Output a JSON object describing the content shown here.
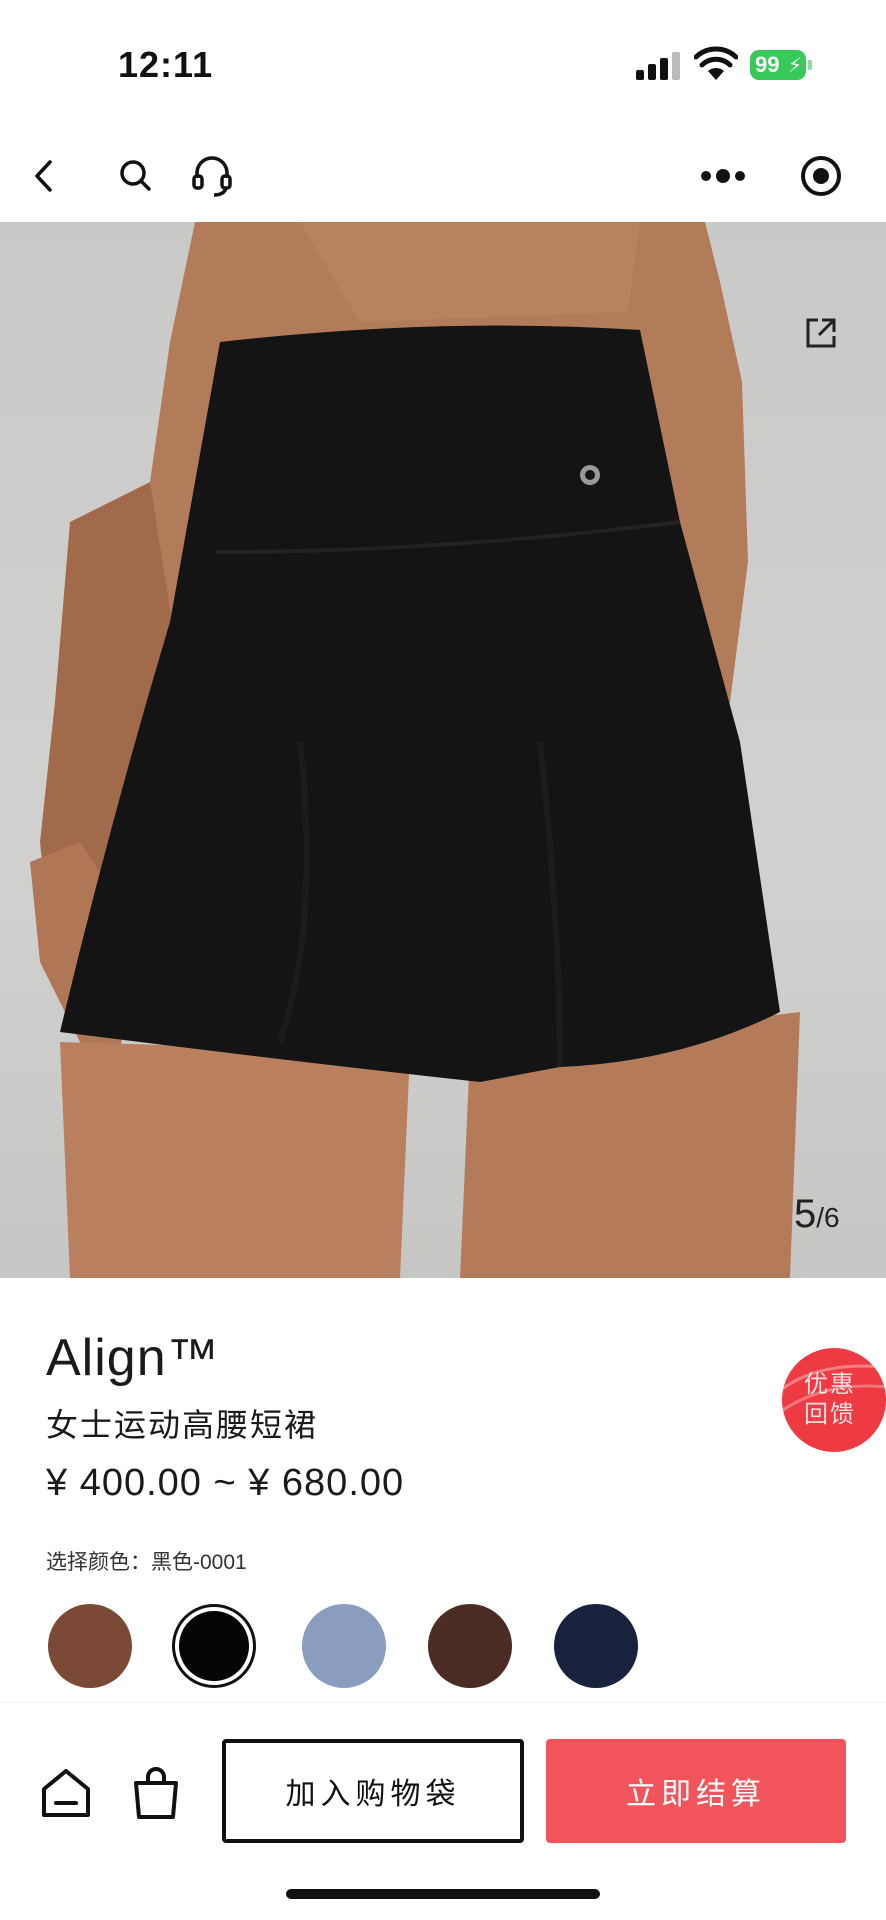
{
  "status_bar": {
    "time": "12:11",
    "battery": "99",
    "icons": [
      "signal-icon",
      "wifi-icon",
      "battery-icon"
    ]
  },
  "nav": {
    "icons": [
      "back-icon",
      "search-icon",
      "customer-service-icon",
      "more-icon",
      "close-miniprogram-icon"
    ]
  },
  "gallery": {
    "current_page": "5",
    "total_pages": "/6",
    "share_icon": "share-icon",
    "image_description_colors": {
      "skirt": "#141414",
      "skin": "#b07a58",
      "background": "#cbcbca"
    }
  },
  "product": {
    "name": "Align™",
    "subtitle": "女士运动高腰短裙",
    "price": "¥ 400.00 ~ ¥ 680.00",
    "color_label": "选择颜色：黑色-0001",
    "promo_badge": "优惠回馈",
    "promo_color": "#ee3b43",
    "swatches": [
      {
        "name": "brown",
        "color": "#7a4a37",
        "selected": false
      },
      {
        "name": "black",
        "color": "#050505",
        "selected": true
      },
      {
        "name": "denim-blue",
        "color": "#8b9dbf",
        "selected": false
      },
      {
        "name": "dark-brown",
        "color": "#4a2c24",
        "selected": false
      },
      {
        "name": "navy",
        "color": "#18223d",
        "selected": false
      }
    ]
  },
  "bottom_bar": {
    "home_icon": "home-icon",
    "bag_icon": "shopping-bag-icon",
    "add_to_bag_label": "加入购物袋",
    "checkout_label": "立即结算",
    "checkout_color": "#f2545b"
  }
}
